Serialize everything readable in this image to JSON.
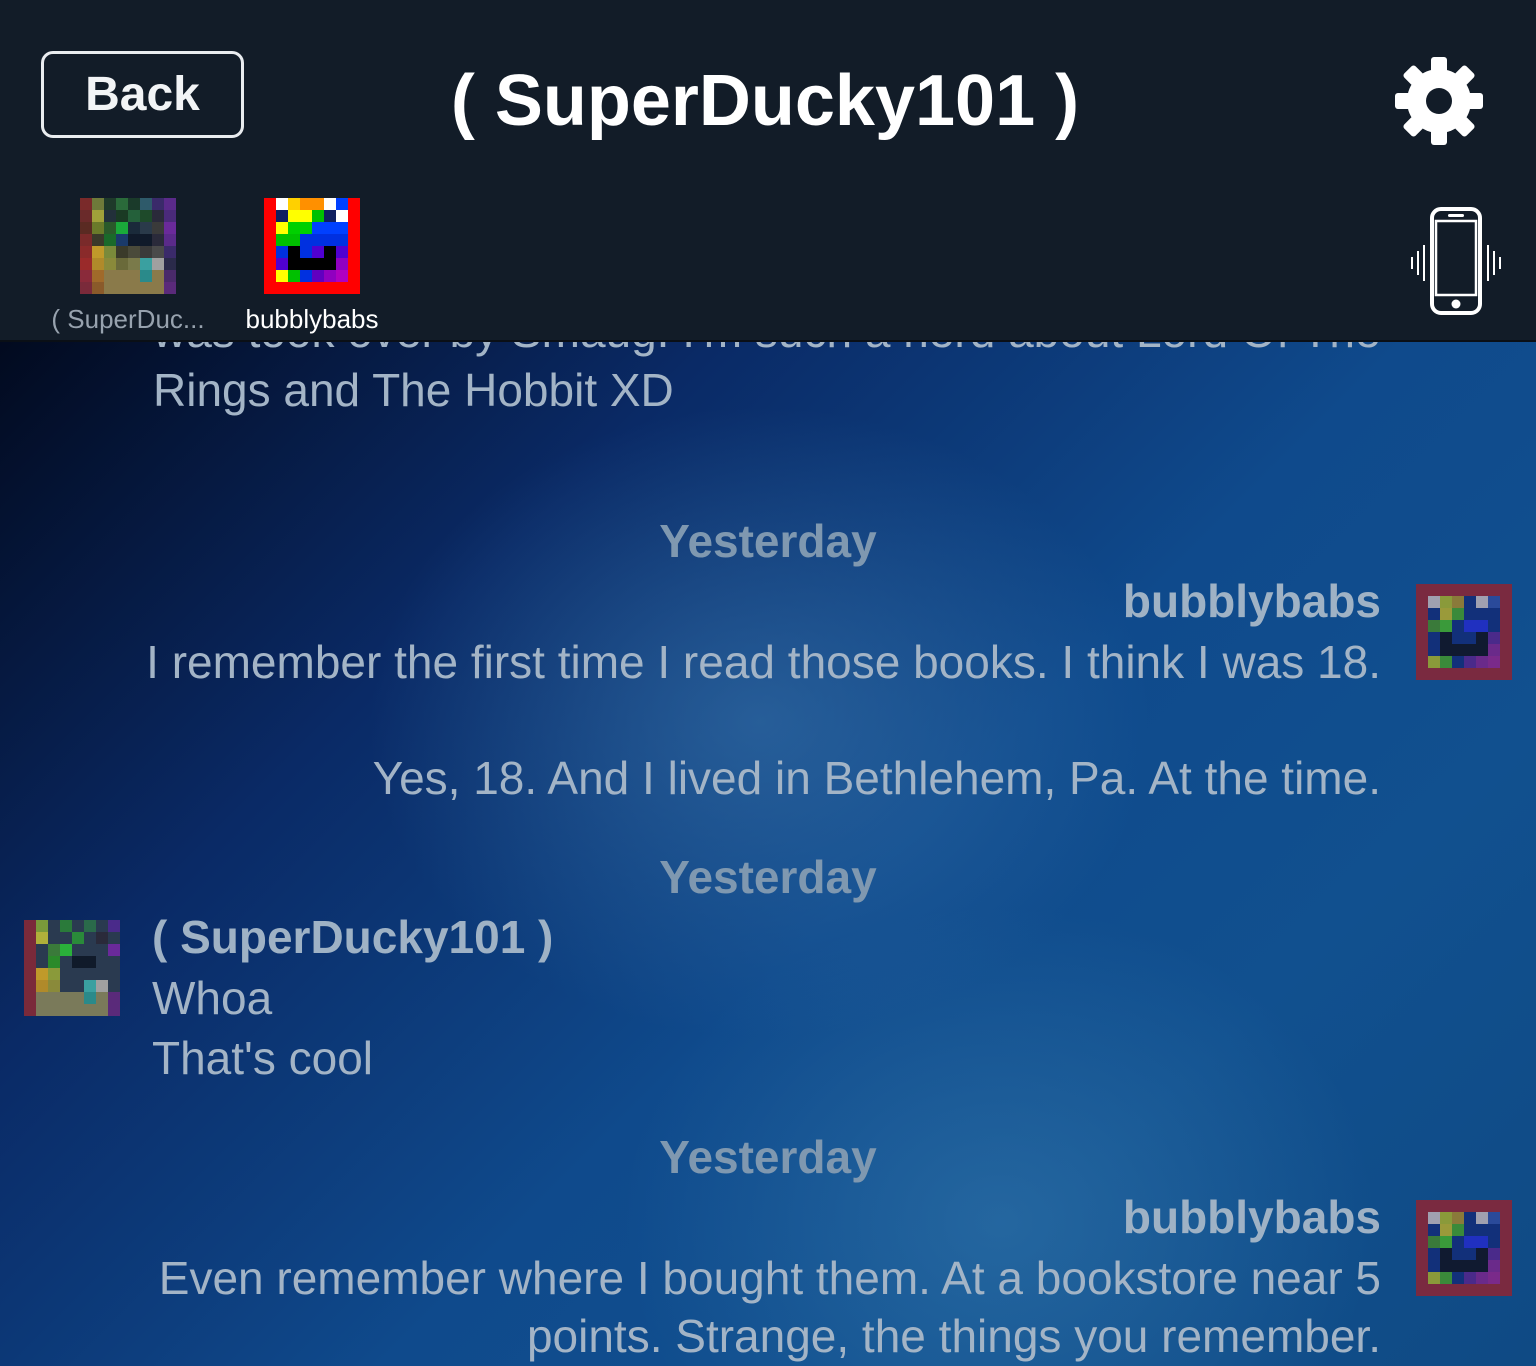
{
  "header": {
    "back_label": "Back",
    "title": "( SuperDucky101 )",
    "settings_icon": "gear-icon",
    "vibrate_icon": "vibrate-phone-icon"
  },
  "participants": [
    {
      "label": "( SuperDuc...",
      "avatar": "pixel-avatar-green"
    },
    {
      "label": "bubblybabs",
      "avatar": "pixel-avatar-rainbow"
    }
  ],
  "chat": {
    "cut_line": "was took over by Smaug. I'm such a nerd about Lord Of The",
    "prev_line": "Rings and The Hobbit XD",
    "groups": [
      {
        "stamp": "Yesterday",
        "sender": "bubblybabs",
        "lines": [
          "I remember the first time I read those books.  I think I was 18.",
          "Yes, 18.  And I lived in Bethlehem, Pa. At the time."
        ]
      },
      {
        "stamp": "Yesterday",
        "sender": "( SuperDucky101 )",
        "lines": [
          "Whoa",
          "That's cool"
        ]
      },
      {
        "stamp": "Yesterday",
        "sender": "bubblybabs",
        "lines": [
          "Even remember where I bought them.  At a bookstore near 5",
          "points.  Strange, the things you remember."
        ]
      }
    ]
  }
}
